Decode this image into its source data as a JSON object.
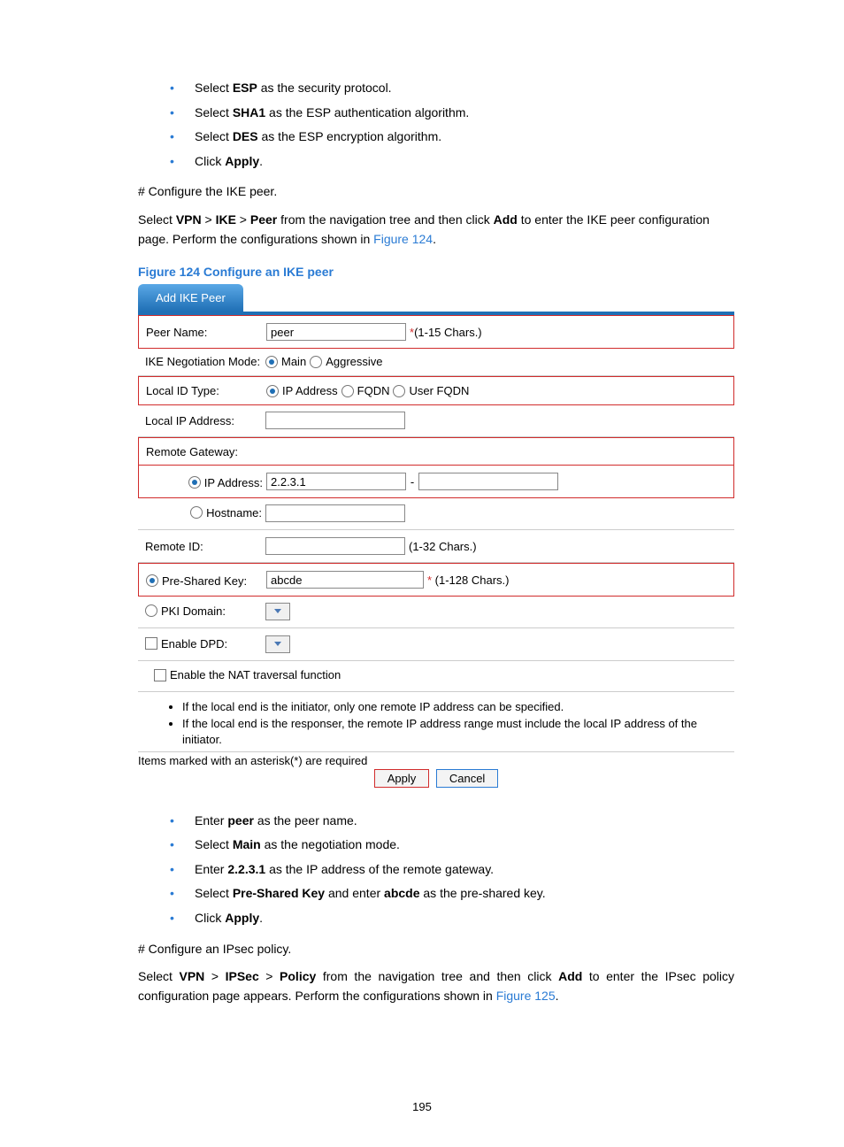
{
  "page_number": "195",
  "intro1": [
    {
      "pre": "Select ",
      "bold": "ESP",
      "post": " as the security protocol."
    },
    {
      "pre": "Select ",
      "bold": "SHA1",
      "post": " as the ESP authentication algorithm."
    },
    {
      "pre": "Select ",
      "bold": "DES",
      "post": " as the ESP encryption algorithm."
    },
    {
      "pre": "Click ",
      "bold": "Apply",
      "post": "."
    }
  ],
  "ike_hash_line": "# Configure the IKE peer.",
  "ike_para": {
    "a": "Select ",
    "b": "VPN",
    "c": " > ",
    "d": "IKE",
    "e": " > ",
    "f": "Peer",
    "g": " from the navigation tree and then click ",
    "h": "Add",
    "i": " to enter the IKE peer configuration page. Perform the configurations shown in ",
    "j": "Figure 124",
    "k": "."
  },
  "fig124_caption": "Figure 124 Configure an IKE peer",
  "form": {
    "tab": "Add IKE Peer",
    "peer_name": {
      "label": "Peer Name:",
      "value": "peer",
      "hint": "(1-15 Chars.)",
      "required": "*"
    },
    "neg": {
      "label": "IKE Negotiation Mode:",
      "opt1": "Main",
      "opt2": "Aggressive"
    },
    "localid": {
      "label": "Local ID Type:",
      "opt1": "IP Address",
      "opt2": "FQDN",
      "opt3": "User FQDN"
    },
    "localip": {
      "label": "Local IP Address:"
    },
    "remote_gw": {
      "label": "Remote Gateway:"
    },
    "remote_ip": {
      "label": "IP Address:",
      "value": "2.2.3.1"
    },
    "hostname": {
      "label": "Hostname:"
    },
    "remoteid": {
      "label": "Remote ID:",
      "hint": "(1-32 Chars.)"
    },
    "psk": {
      "label": "Pre-Shared Key:",
      "value": "abcde",
      "hint": "(1-128 Chars.)",
      "required": "* "
    },
    "pki": {
      "label": "PKI Domain:"
    },
    "dpd": {
      "label": "Enable DPD:"
    },
    "nat": {
      "label": "Enable the NAT traversal function"
    },
    "notes": [
      "If the local end is the initiator, only one remote IP address can be specified.",
      "If the local end is the responser, the remote IP address range must include the local IP address of the initiator."
    ],
    "required_note": "Items marked with an asterisk(*) are required",
    "apply": "Apply",
    "cancel": "Cancel"
  },
  "intro2": [
    {
      "pre": "Enter ",
      "bold": "peer",
      "post": " as the peer name."
    },
    {
      "pre": "Select ",
      "bold": "Main",
      "post": " as the negotiation mode."
    },
    {
      "pre": "Enter ",
      "bold": "2.2.3.1",
      "post": " as the IP address of the remote gateway."
    },
    {
      "psk_pre": "Select ",
      "psk_b1": "Pre-Shared Key",
      "psk_mid": " and enter ",
      "psk_b2": "abcde",
      "psk_post": " as the pre-shared key."
    },
    {
      "pre": "Click ",
      "bold": "Apply",
      "post": "."
    }
  ],
  "ipsec_hash_line": "# Configure an IPsec policy.",
  "ipsec_para": {
    "a": "Select ",
    "b": "VPN",
    "c": " > ",
    "d": "IPSec",
    "e": " > ",
    "f": "Policy",
    "g": " from the navigation tree and then click ",
    "h": "Add",
    "i": " to enter the IPsec policy configuration page appears. Perform the configurations shown in ",
    "j": "Figure 125",
    "k": "."
  }
}
